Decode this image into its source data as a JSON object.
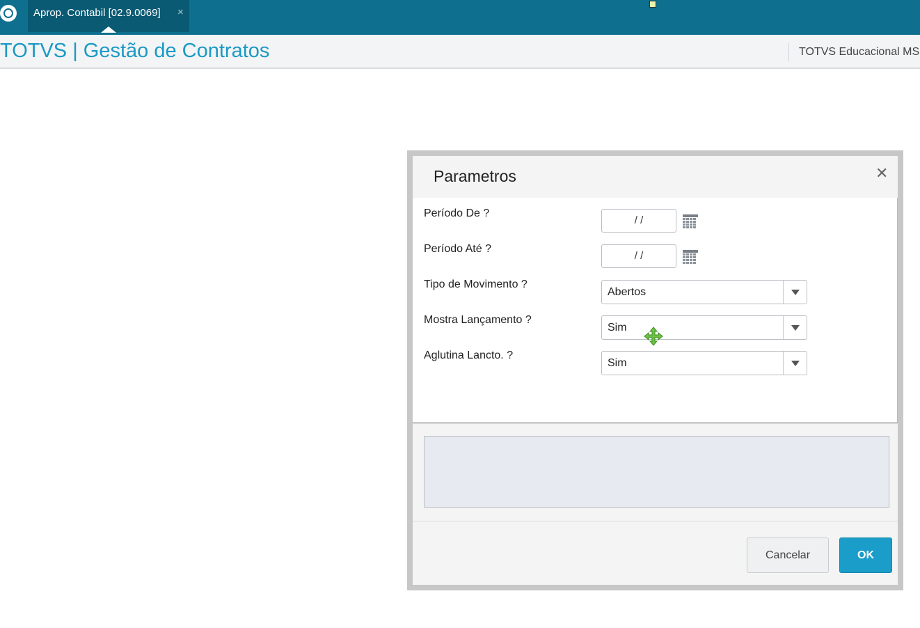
{
  "topbar": {
    "tab_label": "Aprop. Contabil [02.9.0069]",
    "tab_close": "×"
  },
  "header": {
    "app_title": "TOTVS | Gestão de Contratos",
    "company": "TOTVS Educacional MS"
  },
  "dialog": {
    "title": "Parametros",
    "close": "✕",
    "fields": [
      {
        "label": "Período De ?",
        "value": " /  /"
      },
      {
        "label": "Período Até ?",
        "value": " /  /"
      },
      {
        "label": "Tipo de Movimento ?",
        "value": "Abertos"
      },
      {
        "label": "Mostra Lançamento ?",
        "value": "Sim"
      },
      {
        "label": "Aglutina Lancto. ?",
        "value": "Sim"
      }
    ],
    "help_text": "",
    "cancel_label": "Cancelar",
    "ok_label": "OK"
  },
  "colors": {
    "topbar": "#0e6f8e",
    "tab_active": "#0a5a74",
    "title_blue": "#1b99c4",
    "ok_button": "#1a9dc8",
    "help_box": "#e7ebf1"
  },
  "icons": {
    "logo": "totvs-logo-icon",
    "calendar": "calendar-icon",
    "dropdown": "chevron-down-icon",
    "cursor": "move-cursor-icon"
  }
}
